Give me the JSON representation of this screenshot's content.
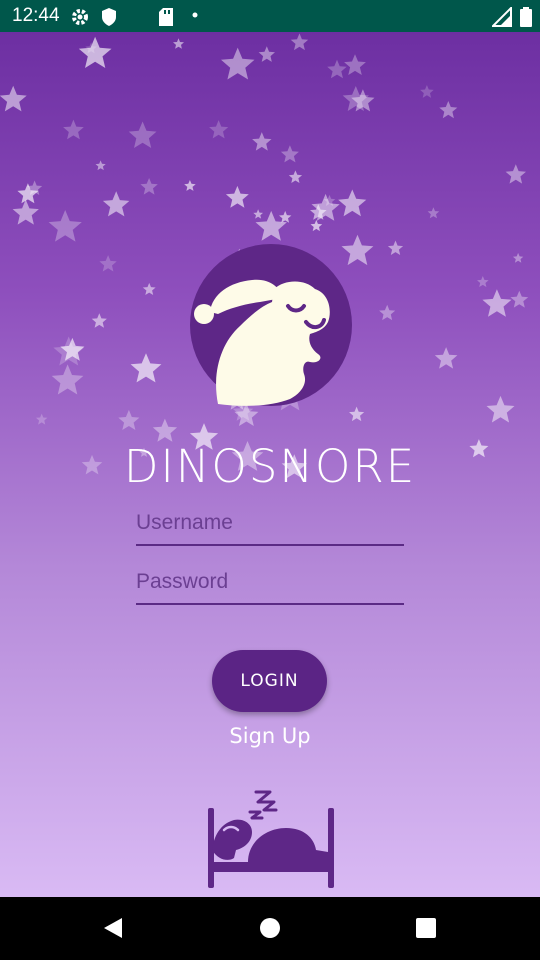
{
  "status_bar": {
    "time": "12:44",
    "icons": [
      "settings-icon",
      "shield-icon",
      "sd-card-icon",
      "dot-icon",
      "signal-icon",
      "battery-icon"
    ]
  },
  "app": {
    "title": "DINOSNORE",
    "username_placeholder": "Username",
    "password_placeholder": "Password",
    "login_label": "LOGIN",
    "signup_label": "Sign Up"
  },
  "colors": {
    "status_bar_bg": "#00574b",
    "gradient_top": "#6d2fa2",
    "gradient_bottom": "#d9baf4",
    "accent": "#5b2485"
  },
  "nav_bar": {
    "icons": [
      "back-icon",
      "home-icon",
      "recents-icon"
    ]
  }
}
